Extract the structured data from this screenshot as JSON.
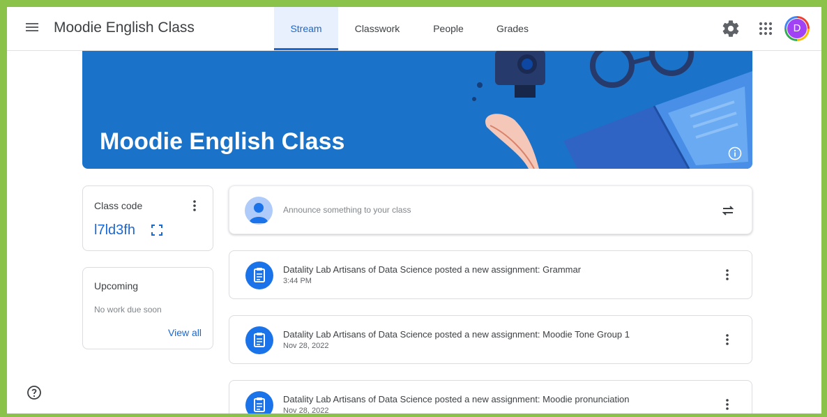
{
  "header": {
    "title": "Moodie English Class",
    "tabs": [
      {
        "label": "Stream"
      },
      {
        "label": "Classwork"
      },
      {
        "label": "People"
      },
      {
        "label": "Grades"
      }
    ],
    "avatar_initial": "D"
  },
  "banner": {
    "title": "Moodie English Class"
  },
  "class_code": {
    "label": "Class code",
    "value": "l7ld3fh"
  },
  "upcoming": {
    "title": "Upcoming",
    "empty_text": "No work due soon",
    "link": "View all"
  },
  "announce": {
    "placeholder": "Announce something to your class"
  },
  "posts": [
    {
      "title": "Datality Lab Artisans of Data Science posted a new assignment: Grammar",
      "date": "3:44 PM"
    },
    {
      "title": "Datality Lab Artisans of Data Science posted a new assignment: Moodie Tone Group 1",
      "date": "Nov 28, 2022"
    },
    {
      "title": "Datality Lab Artisans of Data Science posted a new assignment: Moodie pronunciation",
      "date": "Nov 28, 2022"
    }
  ],
  "colors": {
    "accent": "#1967d2",
    "banner": "#1a73c8",
    "frame": "#8bc34a"
  }
}
